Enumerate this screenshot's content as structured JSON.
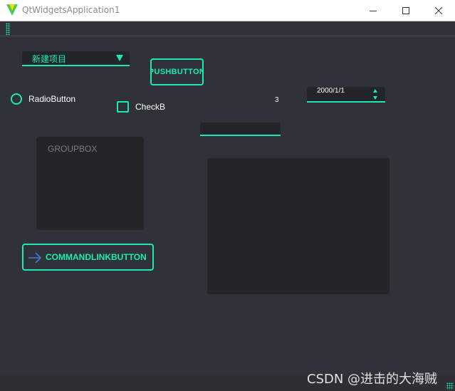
{
  "window": {
    "title": "QtWidgetsApplication1"
  },
  "combo": {
    "value": "新建项目"
  },
  "push_button": {
    "label": "PUSHBUTTON"
  },
  "radio": {
    "label": "RadioButton"
  },
  "checkbox": {
    "label": "CheckBox"
  },
  "stray_text": "3",
  "spinbox": {
    "value": "2000/1/1"
  },
  "line_edit": {
    "value": ""
  },
  "group_box": {
    "title": "GROUPBOX"
  },
  "command_link": {
    "label": "COMMANDLINKBUTTON"
  },
  "watermark": "CSDN @进击的大海贼",
  "colors": {
    "accent": "#1de9b6",
    "background": "#2f3339",
    "surface": "#232629"
  }
}
